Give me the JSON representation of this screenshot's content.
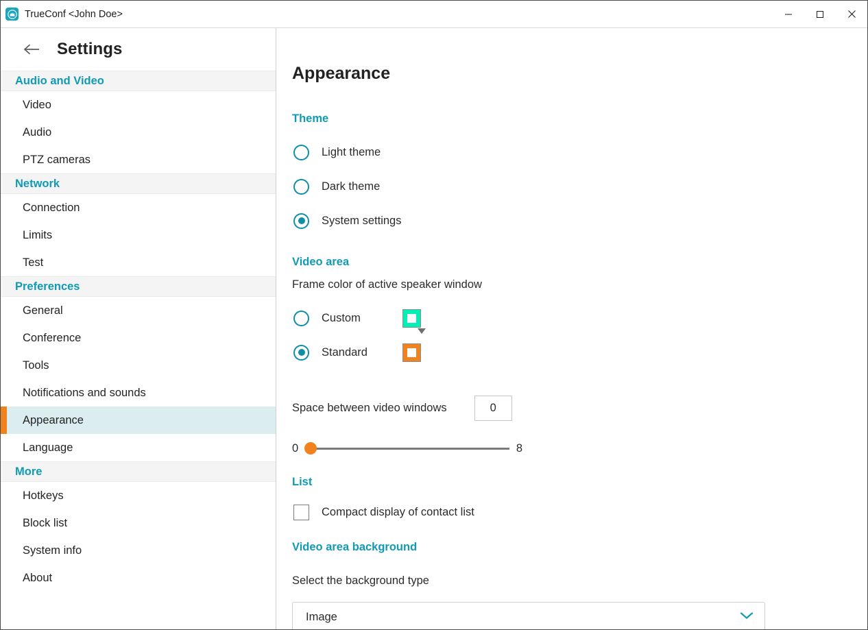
{
  "window": {
    "app_title": "TrueConf <John Doe>",
    "logo_icon": "trueconf-logo-icon",
    "minimize_label": "Minimize",
    "maximize_label": "Maximize",
    "close_label": "Close"
  },
  "sidebar": {
    "back_icon": "back-arrow-icon",
    "title": "Settings",
    "sections": [
      {
        "header": "Audio and Video",
        "items": [
          {
            "label": "Video",
            "selected": false
          },
          {
            "label": "Audio",
            "selected": false
          },
          {
            "label": "PTZ cameras",
            "selected": false
          }
        ]
      },
      {
        "header": "Network",
        "items": [
          {
            "label": "Connection",
            "selected": false
          },
          {
            "label": "Limits",
            "selected": false
          },
          {
            "label": "Test",
            "selected": false
          }
        ]
      },
      {
        "header": "Preferences",
        "items": [
          {
            "label": "General",
            "selected": false
          },
          {
            "label": "Conference",
            "selected": false
          },
          {
            "label": "Tools",
            "selected": false
          },
          {
            "label": "Notifications and sounds",
            "selected": false
          },
          {
            "label": "Appearance",
            "selected": true
          },
          {
            "label": "Language",
            "selected": false
          }
        ]
      },
      {
        "header": "More",
        "items": [
          {
            "label": "Hotkeys",
            "selected": false
          },
          {
            "label": "Block list",
            "selected": false
          },
          {
            "label": "System info",
            "selected": false
          },
          {
            "label": "About",
            "selected": false
          }
        ]
      }
    ]
  },
  "main": {
    "page_title": "Appearance",
    "theme": {
      "section_title": "Theme",
      "options": [
        {
          "label": "Light theme",
          "checked": false
        },
        {
          "label": "Dark theme",
          "checked": false
        },
        {
          "label": "System settings",
          "checked": true
        }
      ]
    },
    "video_area": {
      "section_title": "Video area",
      "frame_color_label": "Frame color of active speaker window",
      "custom": {
        "label": "Custom",
        "checked": false,
        "swatch_color": "#00f0b5",
        "swatch_icon": "color-swatch-icon",
        "caret_icon": "caret-down-icon"
      },
      "standard": {
        "label": "Standard",
        "checked": true,
        "swatch_color": "#f0831e",
        "swatch_icon": "color-swatch-icon"
      },
      "space_label": "Space between video windows",
      "space_value": "0",
      "slider": {
        "min_label": "0",
        "max_label": "8",
        "value": 0,
        "min": 0,
        "max": 8,
        "handle_color": "#f0831e"
      }
    },
    "list": {
      "section_title": "List",
      "compact_label": "Compact display of contact list",
      "compact_checked": false
    },
    "background": {
      "section_title": "Video area background",
      "select_label": "Select the background type",
      "select_value": "Image",
      "chevron_icon": "chevron-down-icon"
    }
  },
  "colors": {
    "accent_teal": "#0f9bb5",
    "accent_orange": "#f0831e",
    "selected_row_bg": "#dcedef",
    "section_header_bg": "#f4f4f4"
  }
}
